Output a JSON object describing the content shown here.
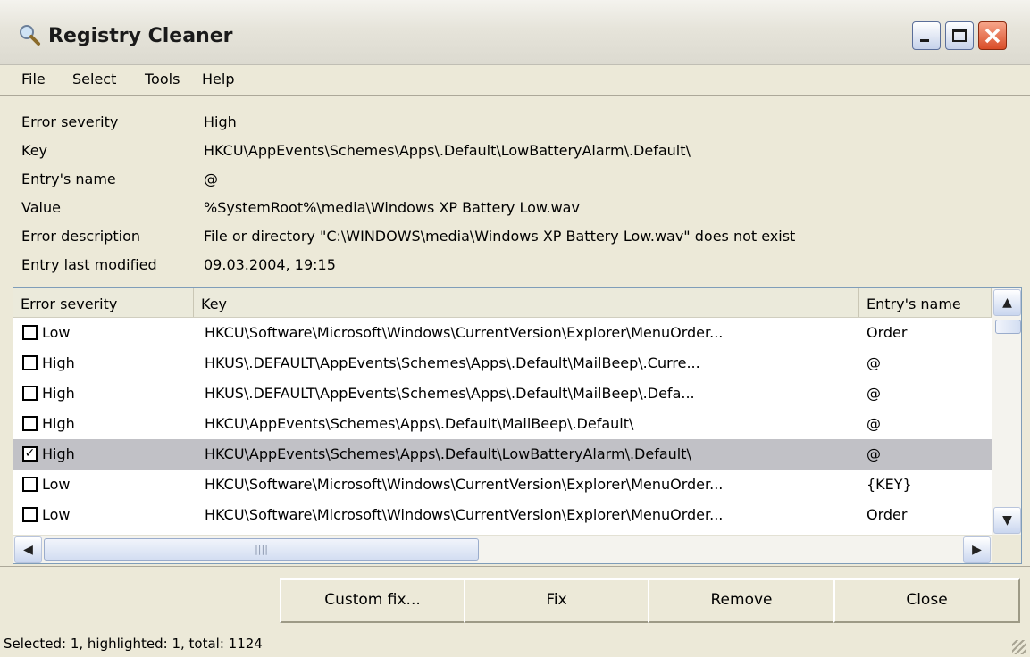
{
  "window": {
    "title": "Registry Cleaner"
  },
  "menu": [
    "File",
    "Select",
    "Tools",
    "Help"
  ],
  "details": [
    {
      "label": "Error severity",
      "value": "High"
    },
    {
      "label": "Key",
      "value": "HKCU\\AppEvents\\Schemes\\Apps\\.Default\\LowBatteryAlarm\\.Default\\"
    },
    {
      "label": "Entry's name",
      "value": "@"
    },
    {
      "label": "Value",
      "value": "%SystemRoot%\\media\\Windows XP Battery Low.wav"
    },
    {
      "label": "Error description",
      "value": "File or directory \"C:\\WINDOWS\\media\\Windows XP Battery Low.wav\" does not exist"
    },
    {
      "label": "Entry last modified",
      "value": "09.03.2004, 19:15"
    }
  ],
  "table": {
    "columns": [
      "Error severity",
      "Key",
      "Entry's name"
    ],
    "rows": [
      {
        "checked": false,
        "selected": false,
        "severity": "Low",
        "key": "HKCU\\Software\\Microsoft\\Windows\\CurrentVersion\\Explorer\\MenuOrder...",
        "name": "Order"
      },
      {
        "checked": false,
        "selected": false,
        "severity": "High",
        "key": "HKUS\\.DEFAULT\\AppEvents\\Schemes\\Apps\\.Default\\MailBeep\\.Curre...",
        "name": "@"
      },
      {
        "checked": false,
        "selected": false,
        "severity": "High",
        "key": "HKUS\\.DEFAULT\\AppEvents\\Schemes\\Apps\\.Default\\MailBeep\\.Defa...",
        "name": "@"
      },
      {
        "checked": false,
        "selected": false,
        "severity": "High",
        "key": "HKCU\\AppEvents\\Schemes\\Apps\\.Default\\MailBeep\\.Default\\",
        "name": "@"
      },
      {
        "checked": true,
        "selected": true,
        "severity": "High",
        "key": "HKCU\\AppEvents\\Schemes\\Apps\\.Default\\LowBatteryAlarm\\.Default\\",
        "name": "@"
      },
      {
        "checked": false,
        "selected": false,
        "severity": "Low",
        "key": "HKCU\\Software\\Microsoft\\Windows\\CurrentVersion\\Explorer\\MenuOrder...",
        "name": "{KEY}"
      },
      {
        "checked": false,
        "selected": false,
        "severity": "Low",
        "key": "HKCU\\Software\\Microsoft\\Windows\\CurrentVersion\\Explorer\\MenuOrder...",
        "name": "Order"
      }
    ]
  },
  "buttons": {
    "custom_fix": "Custom fix...",
    "fix": "Fix",
    "remove": "Remove",
    "close": "Close"
  },
  "status": "Selected: 1, highlighted: 1, total: 1124",
  "colors": {
    "selected_row": "#c1c1c6",
    "close_button": "#d94d28"
  }
}
